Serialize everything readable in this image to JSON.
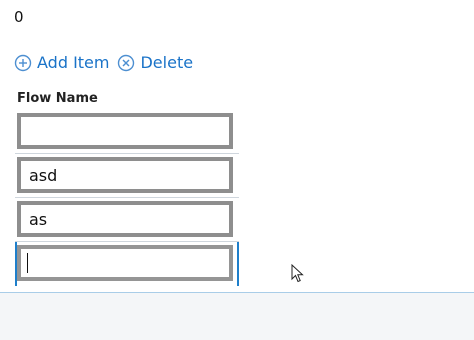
{
  "counter": {
    "value": "0"
  },
  "toolbar": {
    "add_label": "Add Item",
    "delete_label": "Delete",
    "add_icon": "plus-circle-icon",
    "delete_icon": "x-circle-icon",
    "accent_color": "#1a73c8"
  },
  "table": {
    "column_header": "Flow Name",
    "rows": [
      {
        "value": ""
      },
      {
        "value": "asd"
      },
      {
        "value": "as"
      },
      {
        "value": ""
      }
    ]
  }
}
